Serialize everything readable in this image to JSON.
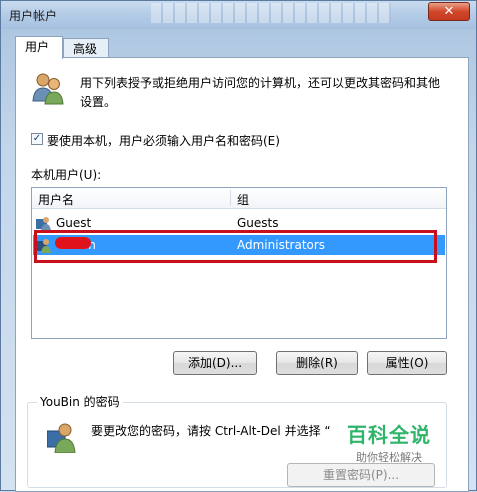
{
  "window": {
    "title": "用户帐户",
    "close_glyph": "✕"
  },
  "tabs": [
    {
      "label": "用户",
      "active": true
    },
    {
      "label": "高级",
      "active": false
    }
  ],
  "description": "用下列表授予或拒绝用户访问您的计算机，还可以更改其密码和其他设置。",
  "require_password": {
    "label": "要使用本机，用户必须输入用户名和密码(E)",
    "checked": true,
    "check_glyph": "✓"
  },
  "users_list": {
    "label": "本机用户(U):",
    "columns": [
      "用户名",
      "组"
    ],
    "rows": [
      {
        "name": "Guest",
        "group": "Guests",
        "selected": false
      },
      {
        "name": "YouBin",
        "group": "Administrators",
        "selected": true
      }
    ]
  },
  "buttons": {
    "add": "添加(D)...",
    "remove": "删除(R)",
    "properties": "属性(O)"
  },
  "password_section": {
    "title": "YouBin 的密码",
    "text": "要更改您的密码，请按 Ctrl-Alt-Del 并选择 “",
    "reset_button": "重置密码(P)..."
  },
  "watermark": {
    "main": "百科全说",
    "sub": "助你轻松解决"
  },
  "colors": {
    "selection": "#3399ff",
    "highlight_box": "#c8101c",
    "watermark": "#2fb56a"
  },
  "icons": [
    "users-icon",
    "user-icon",
    "admin-user-icon",
    "single-user-icon",
    "close-icon",
    "checkmark-icon"
  ]
}
